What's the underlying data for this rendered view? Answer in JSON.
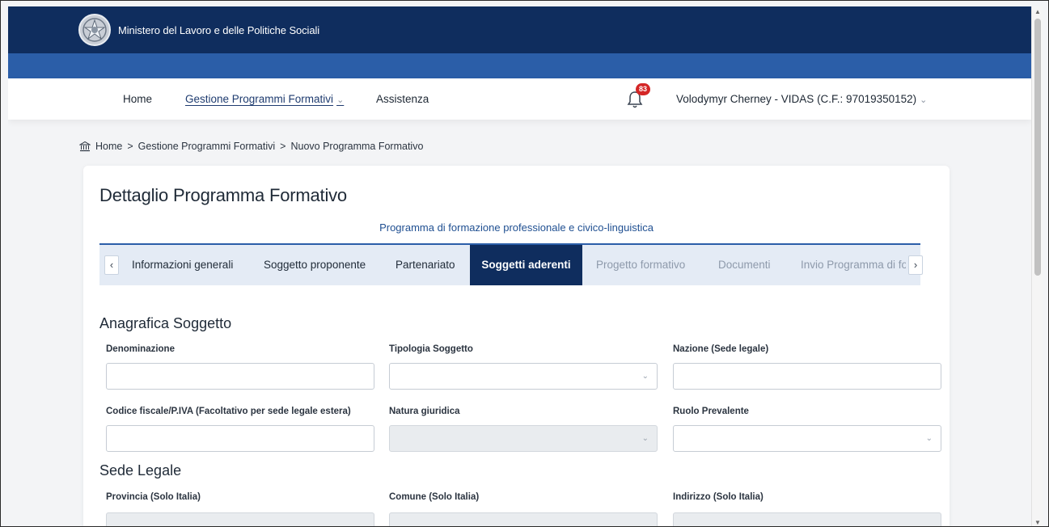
{
  "header": {
    "ministry_name": "Ministero del Lavoro e delle Politiche Sociali",
    "emblem_icon": "italian-republic-emblem",
    "bar_color": "#0f2d5e",
    "band_color": "#2b5ea8"
  },
  "navbar": {
    "items": [
      {
        "label": "Home"
      },
      {
        "label": "Gestione Programmi Formativi"
      },
      {
        "label": "Assistenza"
      }
    ],
    "notifications_count": "83",
    "user_label": "Volodymyr Cherney - VIDAS (C.F.: 97019350152)"
  },
  "breadcrumb": {
    "items": [
      "Home",
      "Gestione Programmi Formativi",
      "Nuovo Programma Formativo"
    ],
    "separator": ">"
  },
  "card": {
    "title": "Dettaglio Programma Formativo",
    "subtitle": "Programma di formazione professionale e civico-linguistica"
  },
  "tabs": {
    "prev_icon": "‹",
    "next_icon": "›",
    "items": [
      {
        "label": "Informazioni generali",
        "state": "normal"
      },
      {
        "label": "Soggetto proponente",
        "state": "normal"
      },
      {
        "label": "Partenariato",
        "state": "normal"
      },
      {
        "label": "Soggetti aderenti",
        "state": "active"
      },
      {
        "label": "Progetto formativo",
        "state": "disabled"
      },
      {
        "label": "Documenti",
        "state": "disabled"
      },
      {
        "label": "Invio Programma di form",
        "state": "disabled"
      }
    ]
  },
  "anagrafica": {
    "title": "Anagrafica Soggetto",
    "fields": [
      {
        "label": "Denominazione",
        "value": "",
        "type": "text"
      },
      {
        "label": "Tipologia Soggetto",
        "value": "",
        "type": "select"
      },
      {
        "label": "Nazione (Sede legale)",
        "value": "",
        "type": "text"
      },
      {
        "label": "Codice fiscale/P.IVA (Facoltativo per sede legale estera)",
        "value": "",
        "type": "text"
      },
      {
        "label": "Natura giuridica",
        "value": "",
        "type": "select-disabled"
      },
      {
        "label": "Ruolo Prevalente",
        "value": "",
        "type": "select"
      }
    ]
  },
  "sede_legale": {
    "title": "Sede Legale",
    "fields": [
      {
        "label": "Provincia (Solo Italia)",
        "value": "",
        "type": "disabled"
      },
      {
        "label": "Comune (Solo Italia)",
        "value": "",
        "type": "disabled"
      },
      {
        "label": "Indirizzo (Solo Italia)",
        "value": "",
        "type": "disabled"
      }
    ]
  }
}
